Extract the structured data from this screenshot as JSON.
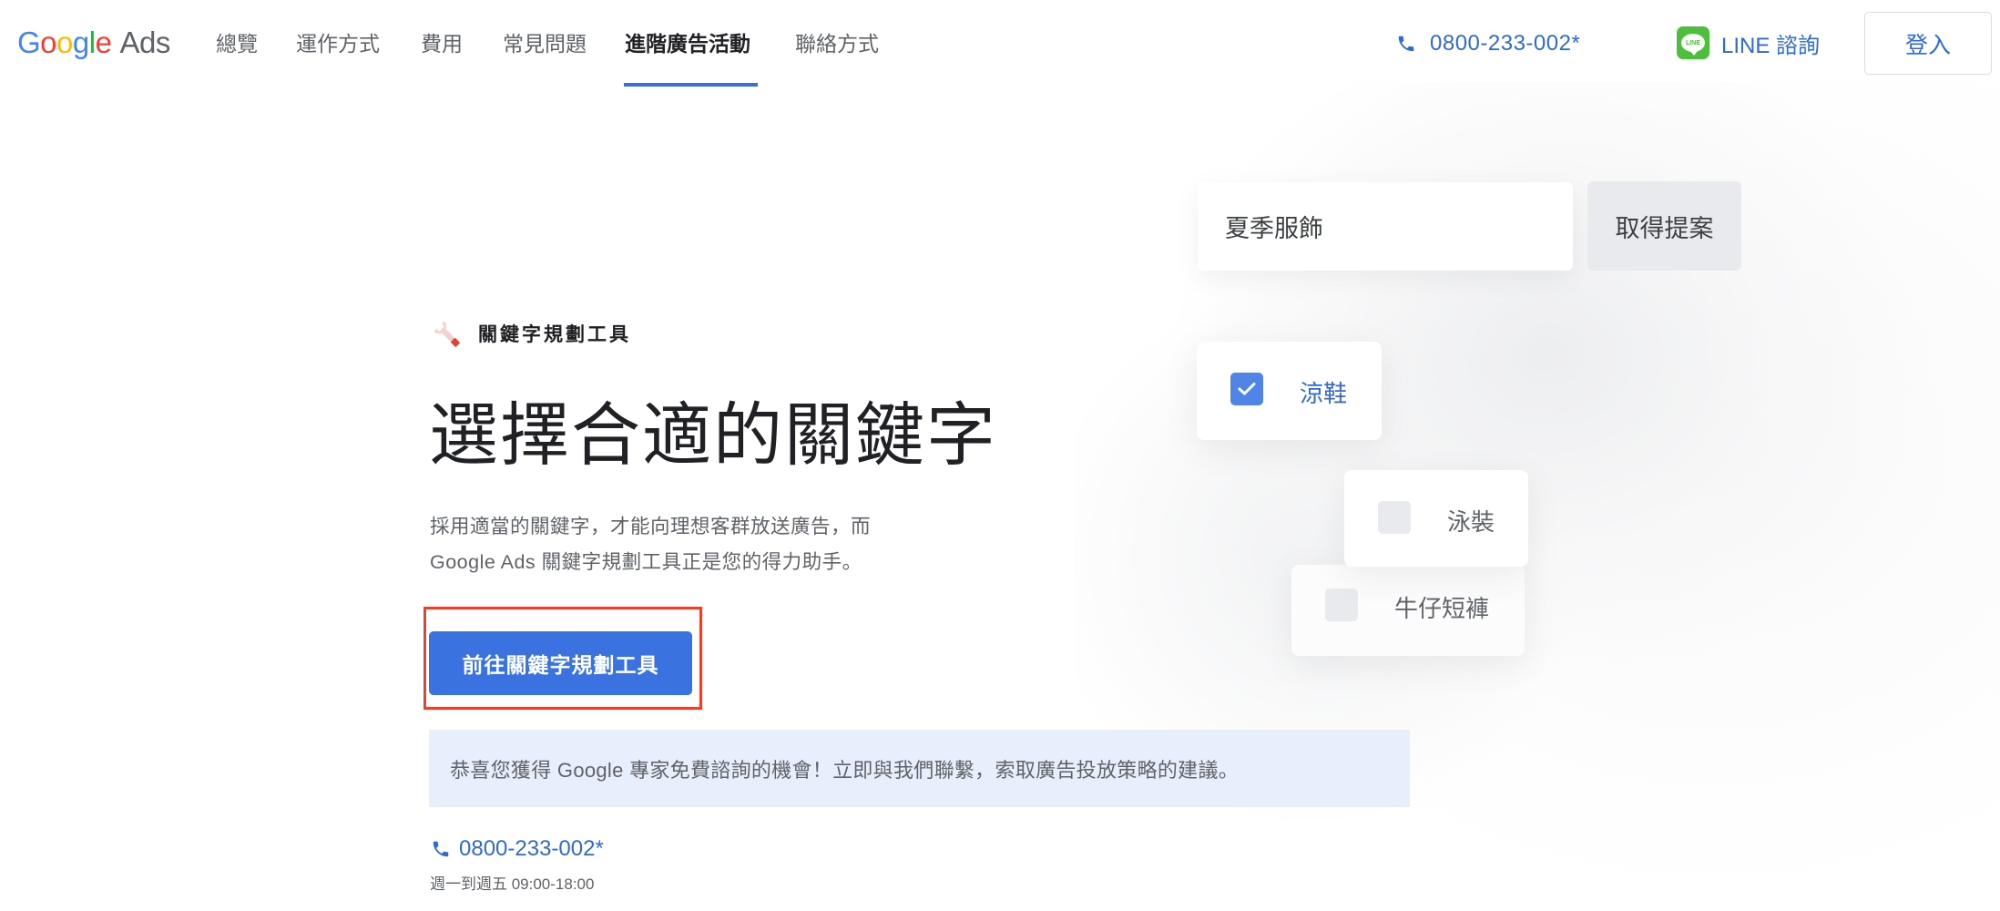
{
  "header": {
    "logo": {
      "google": [
        "G",
        "o",
        "o",
        "g",
        "l",
        "e"
      ],
      "product": "Ads"
    },
    "nav": [
      {
        "label": "總覽",
        "active": false
      },
      {
        "label": "運作方式",
        "active": false
      },
      {
        "label": "費用",
        "active": false
      },
      {
        "label": "常見問題",
        "active": false
      },
      {
        "label": "進階廣告活動",
        "active": true
      },
      {
        "label": "聯絡方式",
        "active": false
      }
    ],
    "phone": {
      "icon": "phone-icon",
      "number": "0800-233-002*"
    },
    "line": {
      "icon": "line-app-icon",
      "icon_text": "LINE",
      "label": "LINE 諮詢"
    },
    "login_label": "登入"
  },
  "hero": {
    "eyebrow_icon": "wrench-icon",
    "eyebrow": "關鍵字規劃工具",
    "title": "選擇合適的關鍵字",
    "description_line1": "採用適當的關鍵字，才能向理想客群放送廣告，而",
    "description_line2": "Google Ads 關鍵字規劃工具正是您的得力助手。",
    "cta_label": "前往關鍵字規劃工具",
    "banner_text": "恭喜您獲得 Google 專家免費諮詢的機會！立即與我們聯繫，索取廣告投放策略的建議。",
    "contact_phone": "0800-233-002*",
    "hours": "週一到週五 09:00-18:00"
  },
  "illustration": {
    "search_value": "夏季服飾",
    "suggest_label": "取得提案",
    "keywords": [
      {
        "label": "涼鞋",
        "checked": true
      },
      {
        "label": "泳裝",
        "checked": false
      },
      {
        "label": "牛仔短褲",
        "checked": false
      }
    ]
  },
  "colors": {
    "brand_blue": "#2f6ad0",
    "cta_blue": "#3a72e0",
    "banner_bg": "#e8effc",
    "highlight_red": "#e0452f",
    "line_green": "#4cc03a"
  }
}
